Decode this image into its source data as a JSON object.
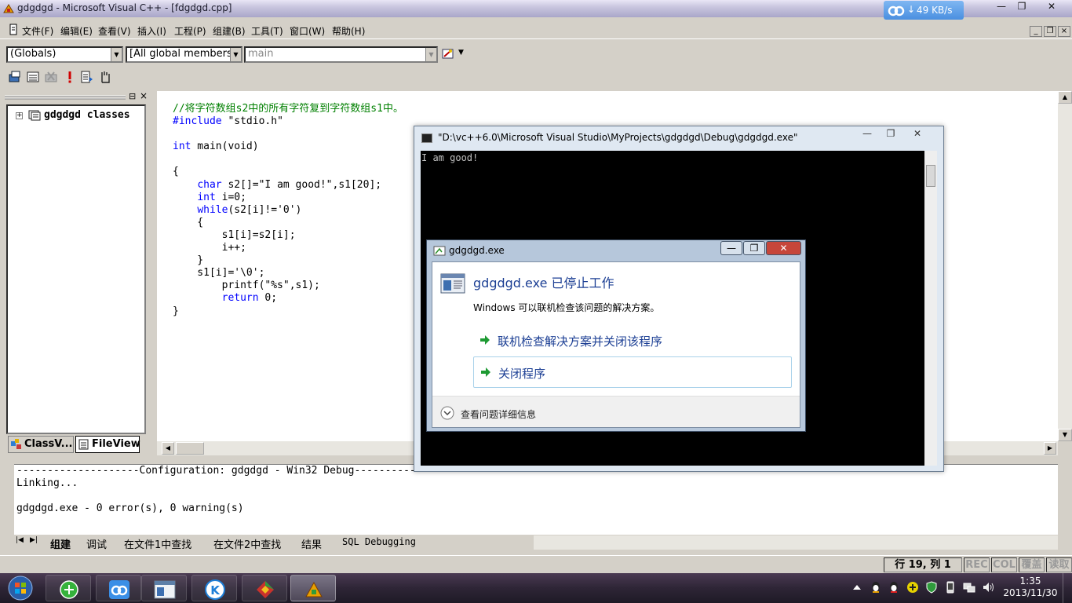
{
  "window": {
    "title": "gdgdgd - Microsoft Visual C++ - [fdgdgd.cpp]",
    "minimize_glyph": "—",
    "maximize_glyph": "❐",
    "close_glyph": "✕"
  },
  "net_widget": {
    "rate": "49 KB/s",
    "icon": "cloud-speed-icon"
  },
  "menu": {
    "items": [
      "文件(F)",
      "编辑(E)",
      "查看(V)",
      "插入(I)",
      "工程(P)",
      "组建(B)",
      "工具(T)",
      "窗口(W)",
      "帮助(H)"
    ],
    "mdi_buttons": [
      "_",
      "❐",
      "×"
    ]
  },
  "wizard_bar": {
    "class_combo": "(Globals)",
    "filter_combo": "[All global members",
    "member_combo": "main",
    "drop_glyph": "▼"
  },
  "build_toolbar": {
    "icons": [
      "compile-icon",
      "build-icon",
      "stop-build-icon",
      "execute-icon",
      "go-icon",
      "insert-breakpoint-icon"
    ]
  },
  "workspace": {
    "header_close": "×",
    "tree_expander": "+",
    "tree_root_label": "gdgdgd classes",
    "tabs": [
      "ClassV...",
      "FileView"
    ]
  },
  "editor": {
    "code_lines": [
      {
        "t": "//将字符数组s2中的所有字符复到字符数组s1中。",
        "k": "cm"
      },
      {
        "t": "#include \"stdio.h\"",
        "k": "inc"
      },
      {
        "t": "",
        "k": ""
      },
      {
        "t": "int main(void)",
        "k": "int"
      },
      {
        "t": "",
        "k": ""
      },
      {
        "t": "{",
        "k": ""
      },
      {
        "t": "    char s2[]=\"I am good!\",s1[20];",
        "k": "char"
      },
      {
        "t": "    int i=0;",
        "k": "int"
      },
      {
        "t": "    while(s2[i]!='0')",
        "k": "while"
      },
      {
        "t": "    {",
        "k": ""
      },
      {
        "t": "        s1[i]=s2[i];",
        "k": ""
      },
      {
        "t": "        i++;",
        "k": ""
      },
      {
        "t": "    }",
        "k": ""
      },
      {
        "t": "    s1[i]='\\0';",
        "k": ""
      },
      {
        "t": "        printf(\"%s\",s1);",
        "k": ""
      },
      {
        "t": "        return 0;",
        "k": "return"
      },
      {
        "t": "}",
        "k": ""
      }
    ]
  },
  "output": {
    "lines": [
      "--------------------Configuration: gdgdgd - Win32 Debug--------------------",
      "Linking...",
      "",
      "gdgdgd.exe - 0 error(s), 0 warning(s)"
    ],
    "tabs": [
      "组建",
      "调试",
      "在文件1中查找",
      "在文件2中查找",
      "结果",
      "SQL Debugging"
    ]
  },
  "statusbar": {
    "position": "行 19, 列 1",
    "indicators": [
      "REC",
      "COL",
      "覆盖",
      "读取"
    ]
  },
  "console": {
    "title": "\"D:\\vc++6.0\\Microsoft Visual Studio\\MyProjects\\gdgdgd\\Debug\\gdgdgd.exe\"",
    "output_text": "I am good!",
    "buttons": [
      "—",
      "❐",
      "✕"
    ]
  },
  "dialog": {
    "title": "gdgdgd.exe",
    "heading": "gdgdgd.exe 已停止工作",
    "description": "Windows 可以联机检查该问题的解决方案。",
    "options": [
      "联机检查解决方案并关闭该程序",
      "关闭程序"
    ],
    "details_label": "查看问题详细信息",
    "buttons": [
      "—",
      "❐",
      "✕"
    ]
  },
  "taskbar": {
    "pinned": [
      "browser-icon",
      "cloud-app-icon",
      "window-app-icon",
      "k-app-icon",
      "media-app-icon",
      "vc-app-icon"
    ],
    "tray_icons": [
      "show-hidden-icon",
      "qq-icon",
      "qq-icon-2",
      "plus-icon",
      "shield-icon",
      "phone-icon",
      "network-icon",
      "volume-icon"
    ],
    "time": "1:35",
    "date": "2013/11/30"
  },
  "colors": {
    "keyword": "#0000ff",
    "comment": "#008000",
    "link_blue": "#1c3f94"
  }
}
